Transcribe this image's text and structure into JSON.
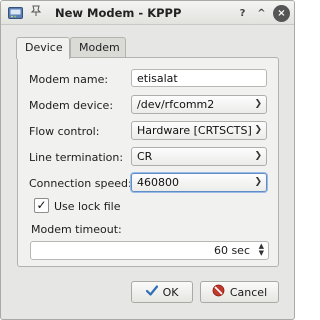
{
  "window": {
    "title": "New Modem - KPPP",
    "help_label": "?",
    "minimize_label": "^",
    "close_label": "×"
  },
  "tabs": [
    {
      "label": "Device",
      "active": true
    },
    {
      "label": "Modem",
      "active": false
    }
  ],
  "form": {
    "modem_name": {
      "label": "Modem name:",
      "value": "etisalat"
    },
    "modem_device": {
      "label": "Modem device:",
      "value": "/dev/rfcomm2"
    },
    "flow_control": {
      "label": "Flow control:",
      "value": "Hardware [CRTSCTS]"
    },
    "line_termination": {
      "label": "Line termination:",
      "value": "CR"
    },
    "connection_speed": {
      "label": "Connection speed:",
      "value": "460800"
    },
    "lock_file": {
      "label": "Use lock file",
      "checked": true
    },
    "modem_timeout": {
      "label": "Modem timeout:",
      "value": "60 sec"
    }
  },
  "buttons": {
    "ok": "OK",
    "cancel": "Cancel"
  },
  "colors": {
    "focus": "#5f8dc8",
    "ok_icon": "#2f6fb5",
    "cancel_icon": "#c0392b"
  },
  "icons": [
    "kppp-app-icon",
    "pin-icon",
    "help-icon",
    "minimize-icon",
    "close-icon",
    "check-icon",
    "cancel-icon"
  ]
}
